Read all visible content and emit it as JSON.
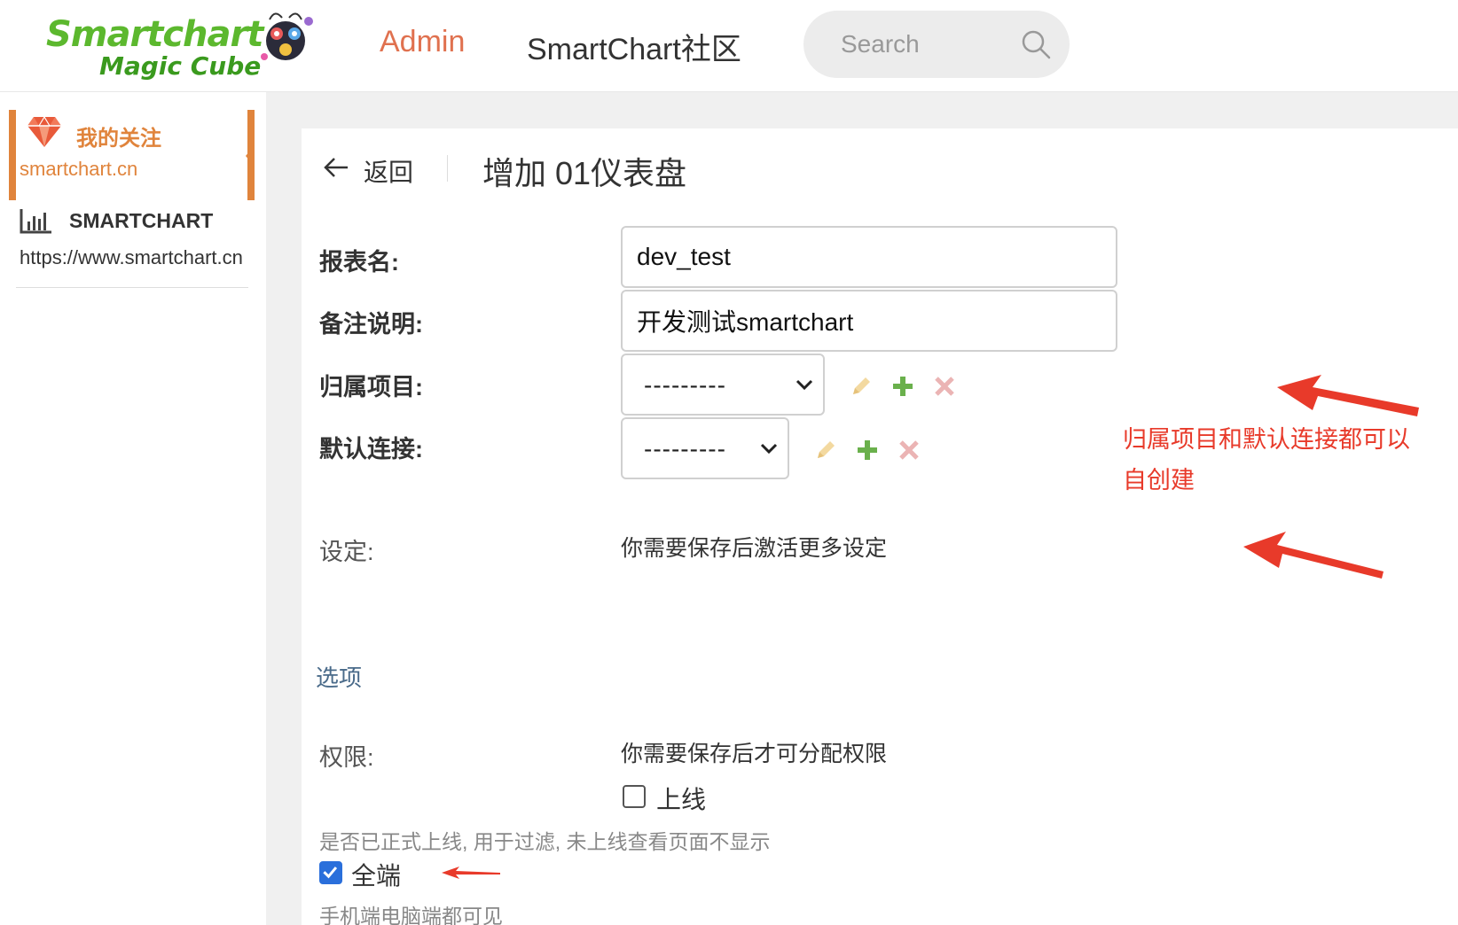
{
  "header": {
    "logo_main": "Smartchart",
    "logo_sub": "Magic Cube",
    "nav": {
      "admin": "Admin",
      "community": "SmartChart社区"
    },
    "search": {
      "placeholder": "Search"
    }
  },
  "sidebar": {
    "active_item": {
      "title": "我的关注",
      "url": "smartchart.cn"
    },
    "item": {
      "title": "SMARTCHART",
      "url": "https://www.smartchart.cn"
    }
  },
  "main": {
    "back_label": "返回",
    "page_title": "增加 01仪表盘",
    "form": {
      "report_name_label": "报表名:",
      "report_name_value": "dev_test",
      "remark_label": "备注说明:",
      "remark_value": "开发测试smartchart",
      "project_label": "归属项目:",
      "project_value": "---------",
      "connection_label": "默认连接:",
      "connection_value": "---------",
      "settings_label": "设定:",
      "settings_hint": "你需要保存后激活更多设定",
      "options_section": "选项",
      "permission_label": "权限:",
      "permission_hint": "你需要保存后才可分配权限",
      "online_label": "上线",
      "online_checked": false,
      "online_help": "是否已正式上线, 用于过滤, 未上线查看页面不显示",
      "all_platform_label": "全端",
      "all_platform_checked": true,
      "all_platform_help": "手机端电脑端都可见"
    },
    "annotation_line1": "归属项目和默认连接都可以",
    "annotation_line2": "自创建"
  },
  "colors": {
    "accent_orange": "#e0843c",
    "admin_link": "#e0714f",
    "logo_green": "#5cb82e",
    "annotation_red": "#e83a2a",
    "checkbox_blue": "#2a6fdb"
  }
}
